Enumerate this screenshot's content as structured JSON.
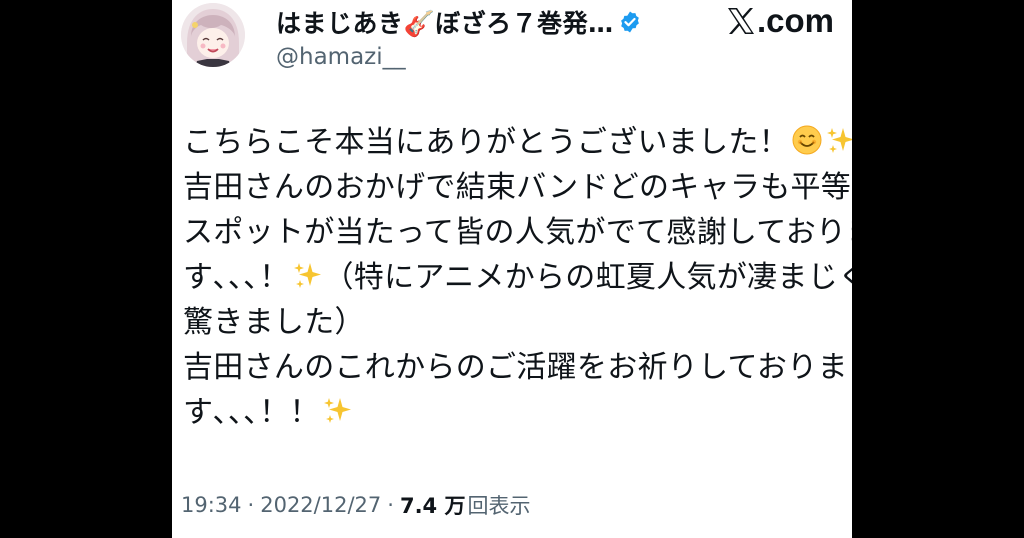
{
  "tweet": {
    "display_name": "はまじあき🎸ぼざろ７巻発…",
    "handle": "@hamazi__",
    "brand_domain": ".com",
    "body_lines": [
      "こちらこそ本当にありがとうございました！",
      "吉田さんのおかげで結束バンドどのキャラも平等に",
      "スポットが当たって皆の人気がでて感謝しておりま",
      "す､､､！",
      "驚きました）",
      "吉田さんのこれからのご活躍をお祈りしておりま",
      "す､､､！！"
    ],
    "body_line4_tail": "（特にアニメからの虹夏人気が凄まじく",
    "time": "19:34",
    "date": "2022/12/27",
    "views_count": "7.4 万",
    "views_label": "回表示",
    "separator": "·"
  },
  "icons": {
    "verified": "verified-badge-icon",
    "brand": "x-logo-icon",
    "smile": "smiling-face-emoji",
    "sparkles": "sparkles-emoji"
  },
  "colors": {
    "verified_blue": "#1d9bf0",
    "text_primary": "#0f1419",
    "text_secondary": "#536471",
    "background": "#000000",
    "sparkle_yellow": "#f7c531"
  }
}
